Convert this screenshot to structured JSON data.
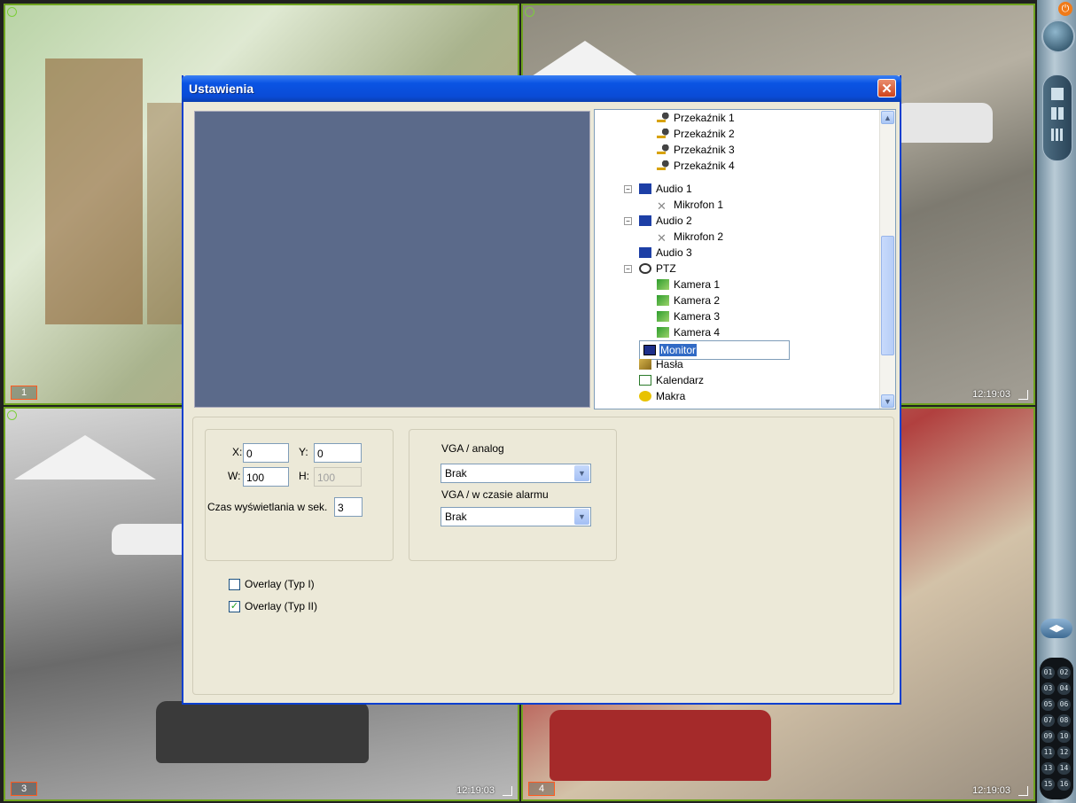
{
  "cameras": [
    {
      "number": "1",
      "time": ""
    },
    {
      "number": "",
      "time": "12:19:03"
    },
    {
      "number": "3",
      "time": "12:19:03"
    },
    {
      "number": "4",
      "time": "12:19:03"
    }
  ],
  "sidebar": {
    "power_icon": "power-icon",
    "channel_buttons": [
      "01",
      "02",
      "03",
      "04",
      "05",
      "06",
      "07",
      "08",
      "09",
      "10",
      "11",
      "12",
      "13",
      "14",
      "15",
      "16"
    ]
  },
  "dialog": {
    "title": "Ustawienia",
    "close_label": "✕",
    "tree": [
      {
        "label": "Przekaźnik 1",
        "icon": "relay-icon"
      },
      {
        "label": "Przekaźnik 2",
        "icon": "relay-icon"
      },
      {
        "label": "Przekaźnik 3",
        "icon": "relay-icon"
      },
      {
        "label": "Przekaźnik 4",
        "icon": "relay-icon"
      },
      {
        "label": "Audio 1",
        "icon": "audio-card-icon"
      },
      {
        "label": "Mikrofon 1",
        "icon": "microphone-off-icon"
      },
      {
        "label": "Audio 2",
        "icon": "audio-card-icon"
      },
      {
        "label": "Mikrofon 2",
        "icon": "microphone-off-icon"
      },
      {
        "label": "Audio 3",
        "icon": "audio-card-icon"
      },
      {
        "label": "PTZ",
        "icon": "ptz-icon"
      },
      {
        "label": "Kamera 1",
        "icon": "ptz-camera-icon"
      },
      {
        "label": "Kamera 2",
        "icon": "ptz-camera-icon"
      },
      {
        "label": "Kamera 3",
        "icon": "ptz-camera-icon"
      },
      {
        "label": "Kamera 4",
        "icon": "ptz-camera-icon"
      },
      {
        "label": "Monitor",
        "icon": "monitor-icon",
        "selected": true
      },
      {
        "label": "Hasła",
        "icon": "keys-icon"
      },
      {
        "label": "Kalendarz",
        "icon": "calendar-icon"
      },
      {
        "label": "Makra",
        "icon": "macro-icon"
      }
    ],
    "position": {
      "x_label": "X:",
      "x_value": "0",
      "y_label": "Y:",
      "y_value": "0",
      "w_label": "W:",
      "w_value": "100",
      "h_label": "H:",
      "h_value": "100",
      "time_label": "Czas wyświetlania w sek.",
      "time_value": "3"
    },
    "vga": {
      "analog_label": "VGA / analog",
      "analog_value": "Brak",
      "alarm_label": "VGA / w czasie alarmu",
      "alarm_value": "Brak"
    },
    "overlay": [
      {
        "label": "Overlay (Typ I)",
        "checked": false
      },
      {
        "label": "Overlay (Typ II)",
        "checked": true
      }
    ]
  }
}
